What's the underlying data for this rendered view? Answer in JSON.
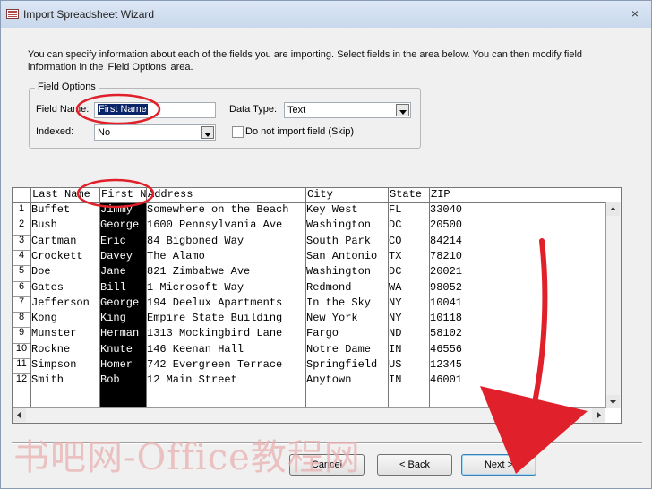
{
  "window": {
    "title": "Import Spreadsheet Wizard",
    "close_glyph": "×"
  },
  "intro_text": "You can specify information about each of the fields you are importing. Select fields in the area below. You can then modify field information in the 'Field Options' area.",
  "field_options": {
    "legend": "Field Options",
    "field_name_label": "Field Name:",
    "field_name_value": "First Name",
    "data_type_label": "Data Type:",
    "data_type_value": "Text",
    "indexed_label": "Indexed:",
    "indexed_value": "No",
    "skip_label": "Do not import field (Skip)",
    "skip_checked": false
  },
  "grid": {
    "headers": [
      "Last Name",
      "First N",
      "Address",
      "City",
      "State",
      "ZIP"
    ],
    "selected_column": "First Name",
    "rows": [
      [
        "1",
        "Buffet",
        "Jimmy",
        "Somewhere on the Beach",
        "Key West",
        "FL",
        "33040"
      ],
      [
        "2",
        "Bush",
        "George",
        "1600 Pennsylvania Ave",
        "Washington",
        "DC",
        "20500"
      ],
      [
        "3",
        "Cartman",
        "Eric",
        "84 Bigboned Way",
        "South Park",
        "CO",
        "84214"
      ],
      [
        "4",
        "Crockett",
        "Davey",
        "The Alamo",
        "San Antonio",
        "TX",
        "78210"
      ],
      [
        "5",
        "Doe",
        "Jane",
        "821 Zimbabwe Ave",
        "Washington",
        "DC",
        "20021"
      ],
      [
        "6",
        "Gates",
        "Bill",
        "1 Microsoft Way",
        "Redmond",
        "WA",
        "98052"
      ],
      [
        "7",
        "Jefferson",
        "George",
        "194 Deelux Apartments",
        "In the Sky",
        "NY",
        "10041"
      ],
      [
        "8",
        "Kong",
        "King",
        "Empire State Building",
        "New York",
        "NY",
        "10118"
      ],
      [
        "9",
        "Munster",
        "Herman",
        "1313 Mockingbird Lane",
        "Fargo",
        "ND",
        "58102"
      ],
      [
        "10",
        "Rockne",
        "Knute",
        "146 Keenan Hall",
        "Notre Dame",
        "IN",
        "46556"
      ],
      [
        "11",
        "Simpson",
        "Homer",
        "742 Evergreen Terrace",
        "Springfield",
        "US",
        "12345"
      ],
      [
        "12",
        "Smith",
        "Bob",
        "12 Main Street",
        "Anytown",
        "IN",
        "46001"
      ]
    ]
  },
  "buttons": {
    "cancel": "Cancel",
    "back": "< Back",
    "next": "Next >"
  },
  "watermark": "书吧网-Office教程网",
  "colors": {
    "annotation": "#e0202a",
    "selection": "#0a246a"
  }
}
